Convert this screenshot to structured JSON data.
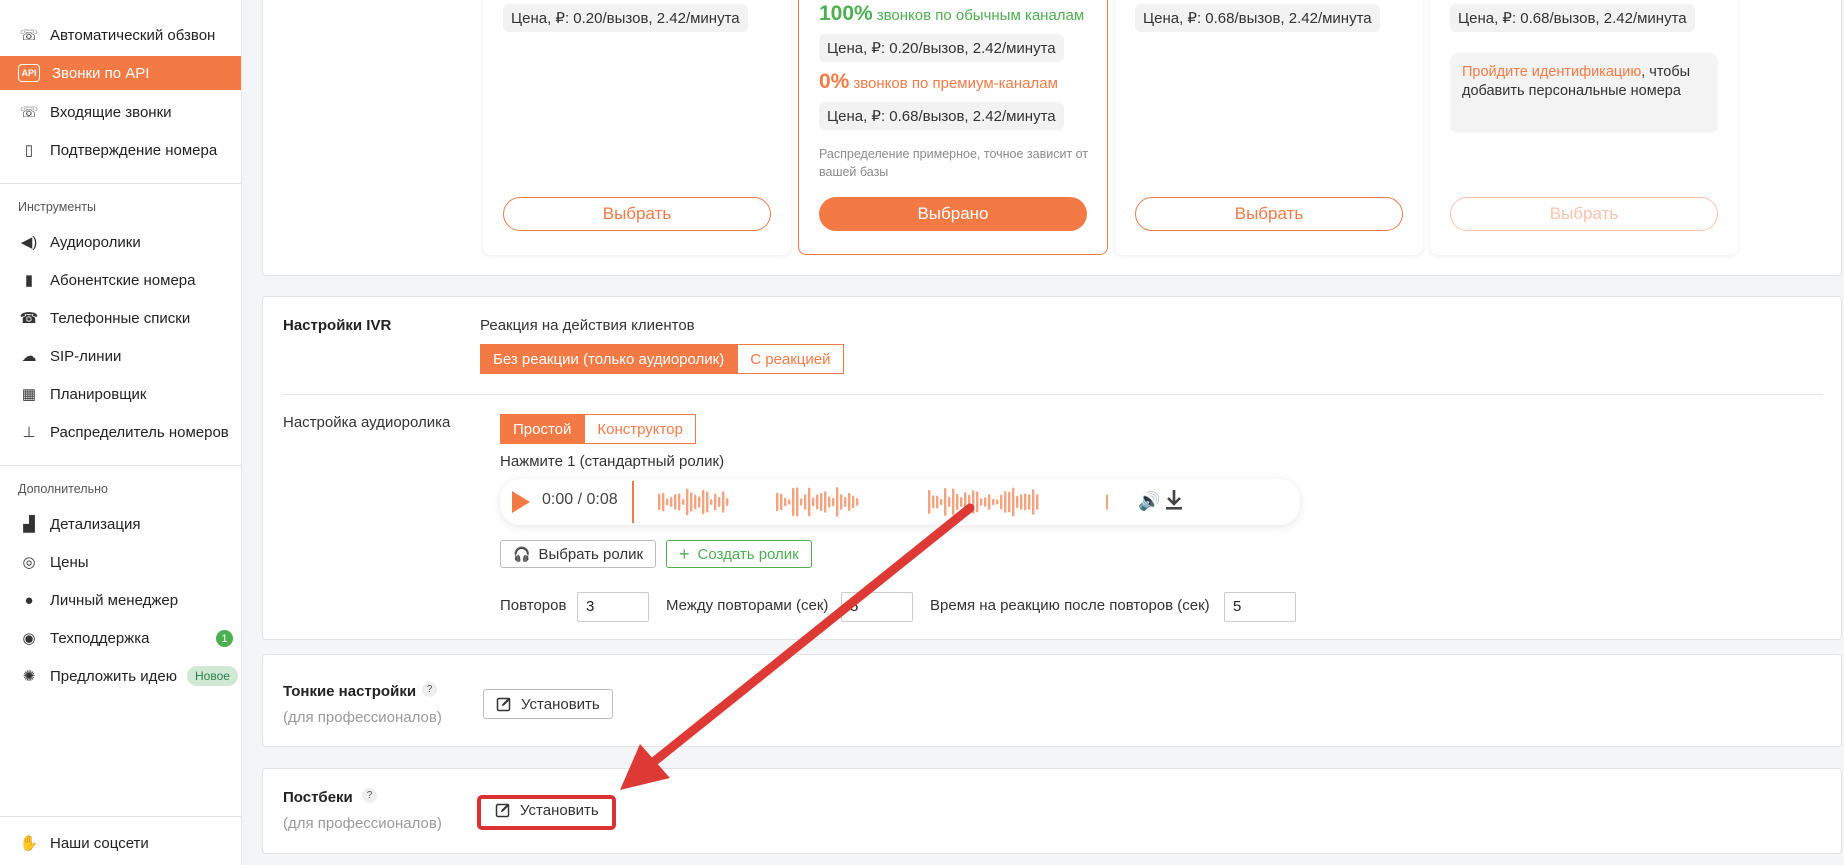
{
  "sidebar": {
    "items_top": [
      {
        "label": "Автоматический обзвон",
        "icon": "phone-icon"
      },
      {
        "label": "Звонки по API",
        "icon": "api-icon",
        "active": true
      },
      {
        "label": "Входящие звонки",
        "icon": "incoming-call-icon"
      },
      {
        "label": "Подтверждение номера",
        "icon": "phone-check-icon"
      }
    ],
    "tools_heading": "Инструменты",
    "tools": [
      {
        "label": "Аудиоролики",
        "icon": "speaker-icon"
      },
      {
        "label": "Абонентские номера",
        "icon": "sim-icon"
      },
      {
        "label": "Телефонные списки",
        "icon": "phonebook-icon"
      },
      {
        "label": "SIP-линии",
        "icon": "cloud-icon"
      },
      {
        "label": "Планировщик",
        "icon": "calendar-icon"
      },
      {
        "label": "Распределитель номеров",
        "icon": "hierarchy-icon"
      }
    ],
    "extra_heading": "Дополнительно",
    "extra": [
      {
        "label": "Детализация",
        "icon": "chart-icon"
      },
      {
        "label": "Цены",
        "icon": "coins-icon"
      },
      {
        "label": "Личный менеджер",
        "icon": "user-icon"
      },
      {
        "label": "Техподдержка",
        "icon": "chat-icon",
        "badge": "1"
      },
      {
        "label": "Предложить идею",
        "icon": "bulb-icon",
        "badge": "Новое"
      }
    ],
    "social": {
      "label": "Наши соцсети",
      "icon": "wave-hand-icon"
    }
  },
  "tariffs": {
    "cards": [
      {
        "price": "Цена, ₽: 0.20/вызов, 2.42/минута",
        "button": "Выбрать"
      },
      {
        "regular_pct": "100%",
        "regular_text": "звонков по обычным каналам",
        "regular_price": "Цена, ₽: 0.20/вызов, 2.42/минута",
        "premium_pct": "0%",
        "premium_text": "звонков по премиум-каналам",
        "premium_price": "Цена, ₽: 0.68/вызов, 2.42/минута",
        "note": "Распределение примерное, точное зависит от вашей базы",
        "button": "Выбрано"
      },
      {
        "price": "Цена, ₽: 0.68/вызов, 2.42/минута",
        "button": "Выбрать"
      },
      {
        "price": "Цена, ₽: 0.68/вызов, 2.42/минута",
        "ident_link": "Пройдите идентификацию",
        "ident_text": ", чтобы добавить персональные номера",
        "button": "Выбрать"
      }
    ]
  },
  "ivr": {
    "title": "Настройки IVR",
    "reaction_label": "Реакция на действия клиентов",
    "reaction_options": [
      "Без реакции (только аудиоролик)",
      "С реакцией"
    ],
    "audio_label": "Настройка аудиоролика",
    "audio_modes": [
      "Простой",
      "Конструктор"
    ],
    "press_label": "Нажмите 1 (стандартный ролик)",
    "player_time": "0:00 / 0:08",
    "choose_clip": "Выбрать ролик",
    "create_clip": "Создать ролик",
    "repeats_label": "Повторов",
    "repeats_value": "3",
    "between_label": "Между повторами (сек)",
    "between_value": "5",
    "reaction_time_label": "Время на реакцию после повторов (сек)",
    "reaction_time_value": "5"
  },
  "fine": {
    "title": "Тонкие настройки",
    "subtitle": "(для профессионалов)",
    "button": "Установить",
    "help": "?"
  },
  "postback": {
    "title": "Постбеки",
    "subtitle": "(для профессионалов)",
    "button": "Установить",
    "help": "?"
  },
  "colors": {
    "accent": "#f47a45",
    "green": "#4caf50",
    "highlight": "#d93232"
  }
}
